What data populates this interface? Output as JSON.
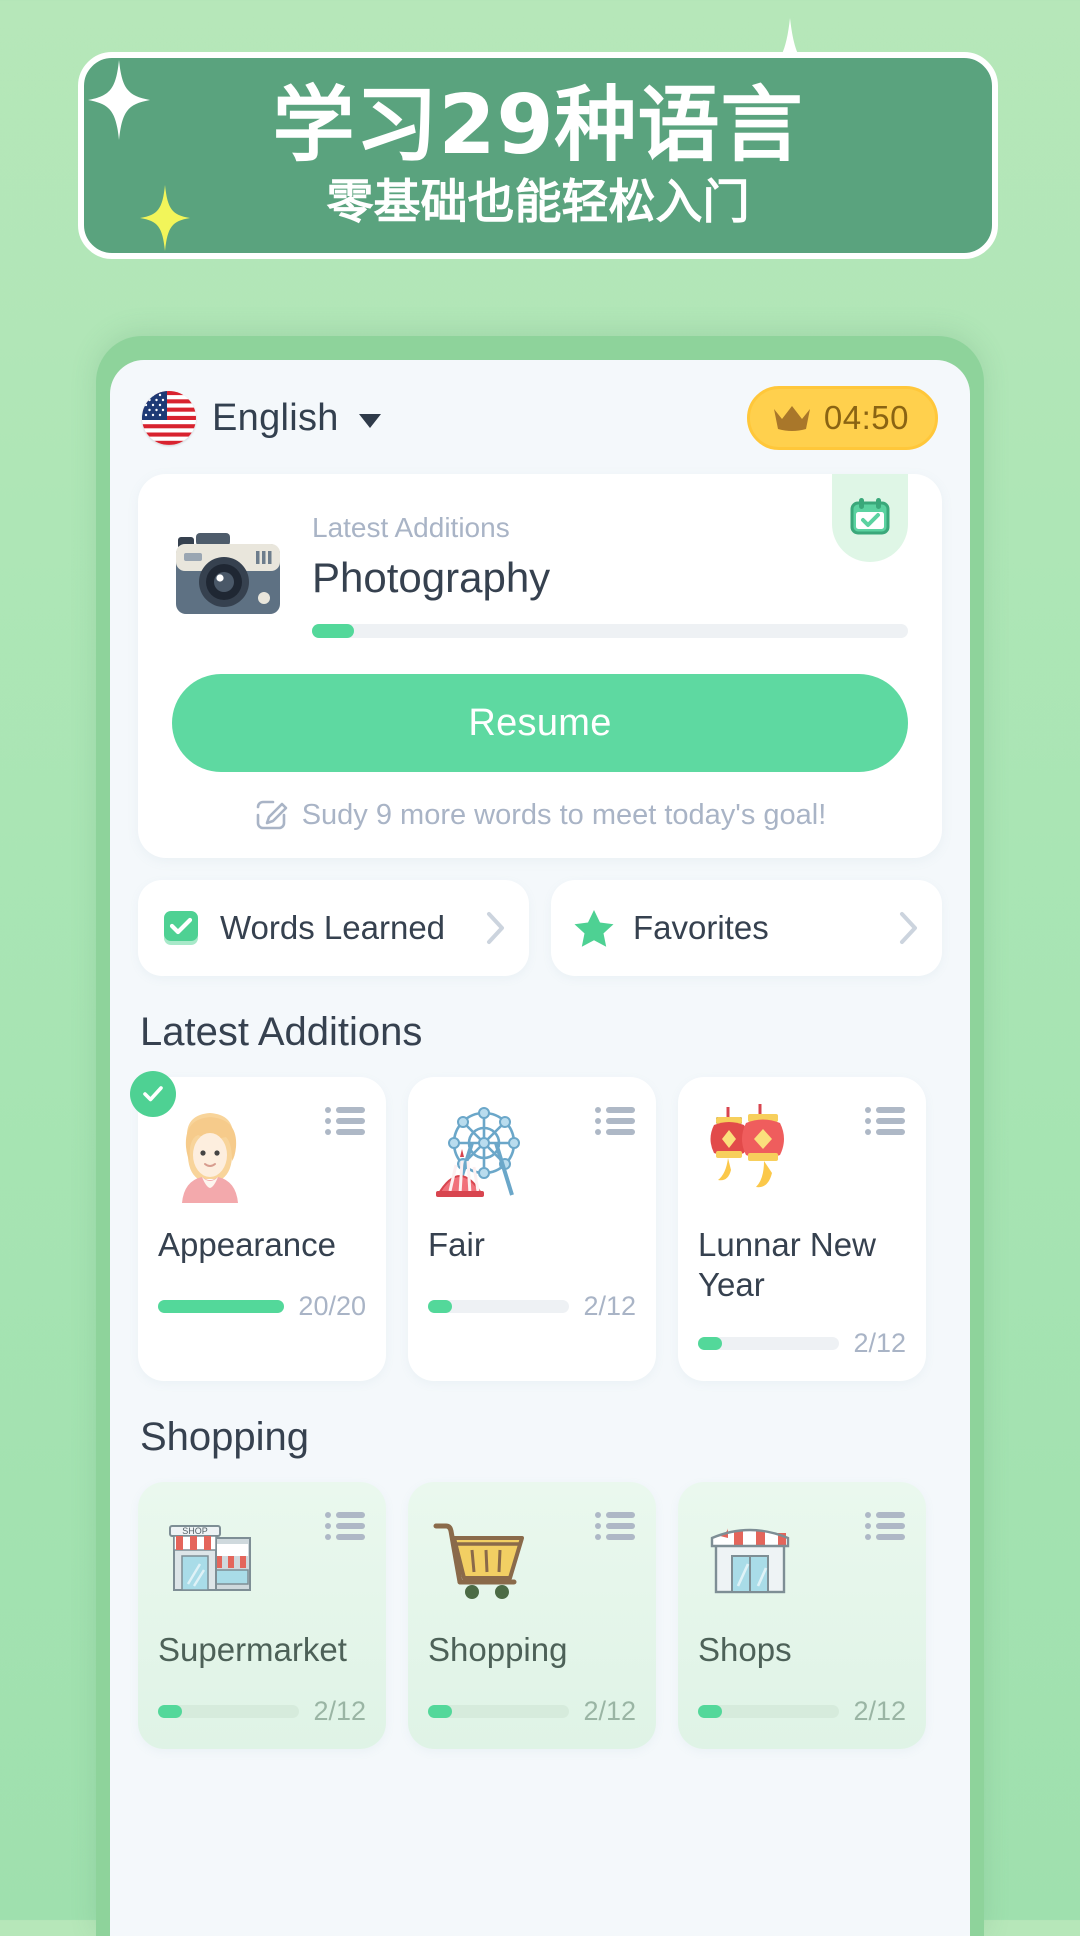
{
  "promo": {
    "title": "学习29种语言",
    "subtitle": "零基础也能轻松入门",
    "box_color": "#5aa37e",
    "border_color": "#ffffff",
    "sparkle_white": "#ffffff",
    "sparkle_yellow": "#f2f55a"
  },
  "app": {
    "header": {
      "flag": "us-flag-icon",
      "language": "English",
      "dropdown_icon": "caret-down-icon",
      "timer": {
        "icon": "crown-icon",
        "value": "04:50",
        "bg": "#ffd04d"
      }
    },
    "main_card": {
      "badge_icon": "calendar-check-icon",
      "thumb_icon": "camera-icon",
      "kicker": "Latest Additions",
      "title": "Photography",
      "progress_percent": 7,
      "button_label": "Resume",
      "goal_icon": "edit-note-icon",
      "goal_text": "Sudy 9 more words to meet today's goal!",
      "accent": "#5ed9a1"
    },
    "shortcuts": [
      {
        "icon": "checkbox-checked-icon",
        "label": "Words Learned",
        "chevron": "chevron-right-icon"
      },
      {
        "icon": "star-icon",
        "label": "Favorites",
        "chevron": "chevron-right-icon"
      }
    ],
    "sections": [
      {
        "title": "Latest Additions",
        "tinted": false,
        "cards": [
          {
            "emoji": "👱‍♀️",
            "icon_name": "woman-face-icon",
            "name": "Appearance",
            "count": "20/20",
            "percent": 100,
            "completed": true,
            "list_icon": "list-icon"
          },
          {
            "emoji": "🎡",
            "icon_name": "ferris-wheel-icon",
            "name": "Fair",
            "count": "2/12",
            "percent": 17,
            "completed": false,
            "list_icon": "list-icon"
          },
          {
            "emoji": "🏮",
            "icon_name": "red-lanterns-icon",
            "name": "Lunnar New Year",
            "count": "2/12",
            "percent": 17,
            "completed": false,
            "list_icon": "list-icon"
          }
        ]
      },
      {
        "title": "Shopping",
        "tinted": true,
        "cards": [
          {
            "emoji": "🏪",
            "icon_name": "convenience-store-icon",
            "name": "Supermarket",
            "count": "2/12",
            "percent": 17,
            "completed": false,
            "list_icon": "list-icon"
          },
          {
            "emoji": "🛒",
            "icon_name": "shopping-cart-icon",
            "name": "Shopping",
            "count": "2/12",
            "percent": 17,
            "completed": false,
            "list_icon": "list-icon"
          },
          {
            "emoji": "🏬",
            "icon_name": "store-front-icon",
            "name": "Shops",
            "count": "2/12",
            "percent": 17,
            "completed": false,
            "list_icon": "list-icon"
          }
        ]
      }
    ]
  }
}
